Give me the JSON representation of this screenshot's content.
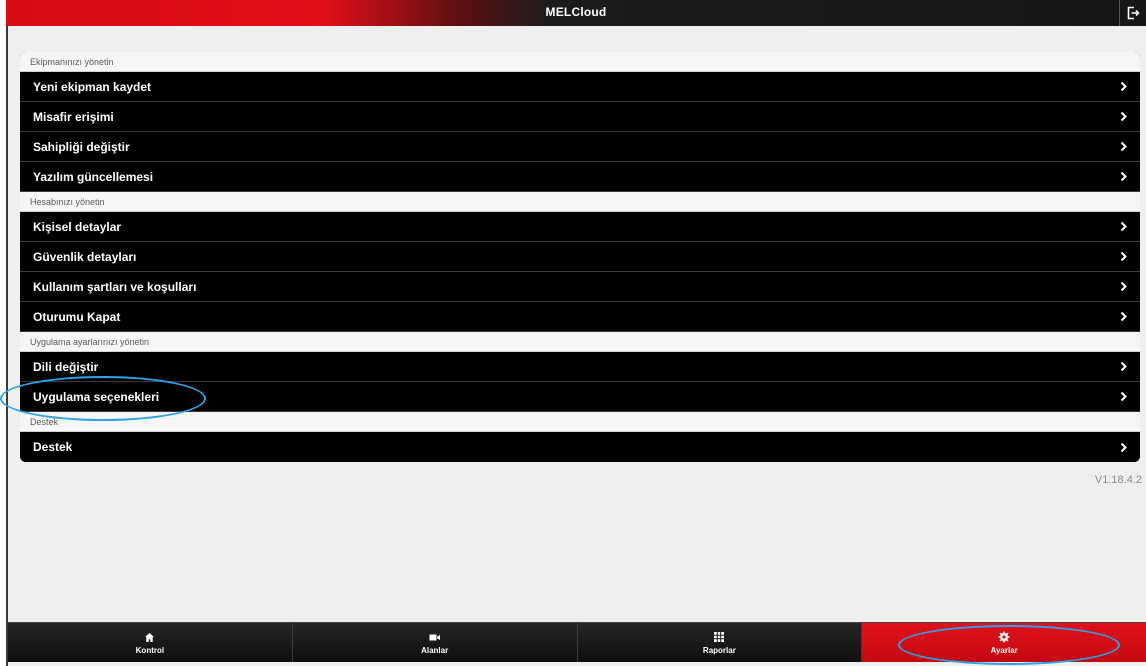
{
  "app": {
    "title": "MELCloud",
    "logout_icon": "logout-icon"
  },
  "sections": [
    {
      "header": "Ekipmanınızı yönetin",
      "items": [
        "Yeni ekipman kaydet",
        "Misafir erişimi",
        "Sahipliği değiştir",
        "Yazılım güncellemesi"
      ]
    },
    {
      "header": "Hesabınızı yönetin",
      "items": [
        "Kişisel detaylar",
        "Güvenlik detayları",
        "Kullanım şartları ve koşulları",
        "Oturumu Kapat"
      ]
    },
    {
      "header": "Uygulama ayarlarınızı yönetin",
      "items": [
        "Dili değiştir",
        "Uygulama seçenekleri"
      ]
    },
    {
      "header": "Destek",
      "items": [
        "Destek"
      ]
    }
  ],
  "version": "V1.18.4.2",
  "nav": [
    {
      "label": "Kontrol",
      "icon": "home-icon"
    },
    {
      "label": "Alanlar",
      "icon": "video-camera-icon"
    },
    {
      "label": "Raporlar",
      "icon": "grid-icon"
    },
    {
      "label": "Ayarlar",
      "icon": "gear-icon",
      "active": true
    }
  ],
  "colors": {
    "accent": "#d80a14",
    "annotation": "#2aa3e8",
    "row_bg": "#000000"
  }
}
